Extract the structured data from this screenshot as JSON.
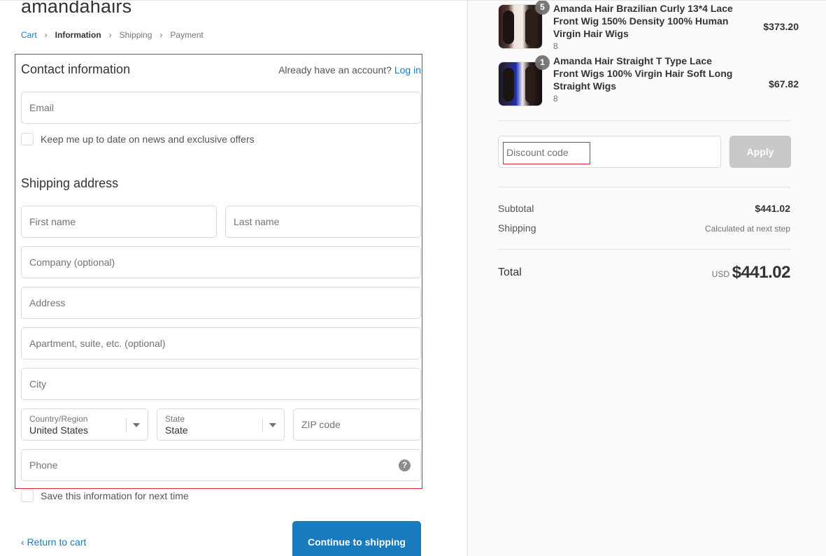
{
  "shop": {
    "name": "amandahairs"
  },
  "breadcrumb": {
    "cart": "Cart",
    "information": "Information",
    "shipping": "Shipping",
    "payment": "Payment",
    "sep": "›"
  },
  "contact": {
    "title": "Contact information",
    "have_account": "Already have an account?",
    "login": "Log in",
    "email_placeholder": "Email",
    "newsletter_label": "Keep me up to date on news and exclusive offers"
  },
  "shipping": {
    "title": "Shipping address",
    "first_name": "First name",
    "last_name": "Last name",
    "company": "Company (optional)",
    "address": "Address",
    "apartment": "Apartment, suite, etc. (optional)",
    "city": "City",
    "country_label": "Country/Region",
    "country_value": "United States",
    "state_label": "State",
    "state_value": "State",
    "zip": "ZIP code",
    "phone": "Phone",
    "help_glyph": "?",
    "save_label": "Save this information for next time"
  },
  "nav": {
    "return": "‹ Return to cart",
    "continue": "Continue to shipping"
  },
  "order": {
    "items": [
      {
        "title": "Amanda Hair Brazilian Curly 13*4 Lace Front Wig 150% Density 100% Human Virgin Hair Wigs",
        "variant": "8",
        "price": "$373.20",
        "quantity": "5"
      },
      {
        "title": "Amanda Hair Straight T Type Lace Front Wigs 100% Virgin Hair Soft Long Straight Wigs",
        "variant": "8",
        "price": "$67.82",
        "quantity": "1"
      }
    ],
    "discount_placeholder": "Discount code",
    "apply": "Apply",
    "subtotal_label": "Subtotal",
    "subtotal_value": "$441.02",
    "shipping_label": "Shipping",
    "shipping_value": "Calculated at next step",
    "total_label": "Total",
    "currency": "USD",
    "total_value": "$441.02"
  },
  "colors": {
    "link": "#197bbd",
    "annotation": "#d9262f",
    "apply_disabled": "#c8c8c8"
  }
}
